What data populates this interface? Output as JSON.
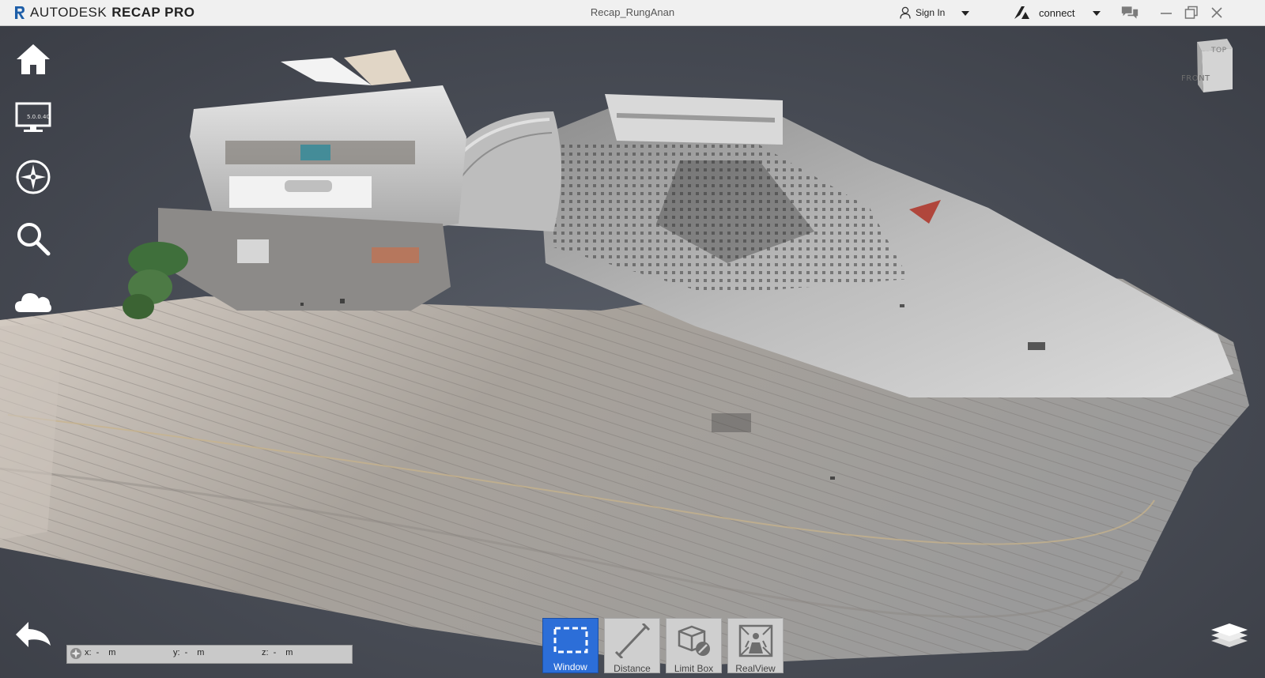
{
  "window": {
    "brand": "AUTODESK",
    "product": "RECAP PRO",
    "document_title": "Recap_RungAnan",
    "sign_in_label": "Sign In",
    "connect_label": "connect"
  },
  "left_toolbar": {
    "items": [
      {
        "name": "home",
        "icon": "home-icon"
      },
      {
        "name": "display-settings",
        "icon": "monitor-icon",
        "label": "5.0.0.40"
      },
      {
        "name": "navigation",
        "icon": "compass-icon"
      },
      {
        "name": "search",
        "icon": "magnifier-icon"
      },
      {
        "name": "cloud",
        "icon": "cloud-icon"
      }
    ]
  },
  "view_cube": {
    "top_label": "TOP",
    "front_label": "FRONT"
  },
  "coordinates": {
    "x_label": "x:",
    "x_value": "-",
    "x_unit": "m",
    "y_label": "y:",
    "y_value": "-",
    "y_unit": "m",
    "z_label": "z:",
    "z_value": "-",
    "z_unit": "m"
  },
  "bottom_toolbar": {
    "tools": [
      {
        "label": "Window",
        "icon": "selection-window-icon",
        "active": true
      },
      {
        "label": "Distance",
        "icon": "measure-distance-icon",
        "active": false
      },
      {
        "label": "Limit Box",
        "icon": "limit-box-icon",
        "active": false
      },
      {
        "label": "RealView",
        "icon": "realview-icon",
        "active": false
      }
    ]
  },
  "colors": {
    "titlebar_bg": "#f0f0f0",
    "viewport_bg": "#4a4e57",
    "active_tool": "#2c6ed8",
    "tool_bg": "#cfcfcf"
  }
}
